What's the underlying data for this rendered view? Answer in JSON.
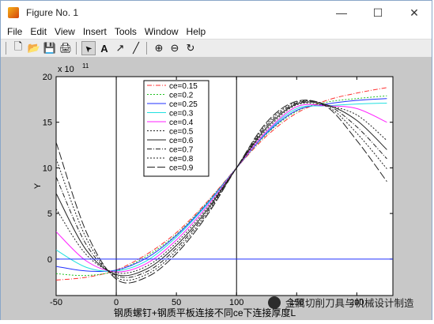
{
  "window": {
    "title": "Figure No. 1",
    "minimize": "—",
    "maximize": "☐",
    "close": "✕"
  },
  "menu": [
    "File",
    "Edit",
    "View",
    "Insert",
    "Tools",
    "Window",
    "Help"
  ],
  "toolbar": [
    {
      "name": "new-icon",
      "glyph": "🗋"
    },
    {
      "name": "open-icon",
      "glyph": "📂"
    },
    {
      "name": "save-icon",
      "glyph": "💾"
    },
    {
      "name": "print-icon",
      "glyph": "🖨"
    },
    {
      "name": "arrow-pointer-icon",
      "glyph": "➤"
    },
    {
      "name": "insert-text-icon",
      "glyph": "A"
    },
    {
      "name": "insert-arrow-icon",
      "glyph": "↗"
    },
    {
      "name": "insert-line-icon",
      "glyph": "╱"
    },
    {
      "name": "zoom-in-icon",
      "glyph": "⊕"
    },
    {
      "name": "zoom-out-icon",
      "glyph": "⊖"
    },
    {
      "name": "rotate-icon",
      "glyph": "↻"
    }
  ],
  "watermark": "金属切削刀具与机械设计制造",
  "chart_data": {
    "type": "line",
    "title": "",
    "xlabel": "钢质螺钉+钢质平板连接不同ce下连接厚度L",
    "ylabel": "Y",
    "y_exponent": "x 10",
    "y_exponent_power": "11",
    "xlim": [
      -50,
      230
    ],
    "ylim": [
      -4,
      20
    ],
    "xticks": [
      -50,
      0,
      50,
      100,
      150,
      200
    ],
    "xtick_labels": [
      "-50",
      "0",
      "50",
      "100",
      "150",
      "200"
    ],
    "yticks": [
      0,
      5,
      10,
      15,
      20
    ],
    "ytick_labels": [
      "0",
      "5",
      "10",
      "15",
      "20"
    ],
    "vlines": [
      0,
      100
    ],
    "hline": 0,
    "legend_position": "top-left",
    "series": [
      {
        "name": "ce=0.15",
        "color": "#ff3030",
        "dash": "6,2,1,2",
        "x": [
          -50,
          -25,
          0,
          25,
          50,
          75,
          100,
          125,
          150,
          175,
          200,
          225
        ],
        "y": [
          -2.3,
          -2.0,
          -1.2,
          0.5,
          2.9,
          6.2,
          10.0,
          13.5,
          16.0,
          17.4,
          18.2,
          18.8
        ]
      },
      {
        "name": "ce=0.2",
        "color": "#20c020",
        "dash": "2,2",
        "x": [
          -50,
          -25,
          0,
          25,
          50,
          75,
          100,
          125,
          150,
          175,
          200,
          225
        ],
        "y": [
          -1.6,
          -1.8,
          -1.3,
          0.3,
          2.7,
          6.1,
          10.0,
          13.7,
          16.2,
          17.2,
          17.6,
          17.9
        ]
      },
      {
        "name": "ce=0.25",
        "color": "#2030ff",
        "dash": "",
        "x": [
          -50,
          -25,
          0,
          25,
          50,
          75,
          100,
          125,
          150,
          175,
          200,
          225
        ],
        "y": [
          -0.8,
          -1.3,
          -1.2,
          0.1,
          2.6,
          6.0,
          10.0,
          13.8,
          16.3,
          17.0,
          17.4,
          17.6
        ]
      },
      {
        "name": "ce=0.3",
        "color": "#20e0e0",
        "dash": "",
        "x": [
          -50,
          -25,
          0,
          25,
          50,
          75,
          100,
          125,
          150,
          175,
          200,
          225
        ],
        "y": [
          1.0,
          -0.9,
          -1.3,
          -0.2,
          2.4,
          5.9,
          10.0,
          13.9,
          16.5,
          16.8,
          17.0,
          17.1
        ]
      },
      {
        "name": "ce=0.4",
        "color": "#ff20ff",
        "dash": "",
        "x": [
          -50,
          -25,
          0,
          25,
          50,
          75,
          100,
          125,
          150,
          175,
          200,
          225
        ],
        "y": [
          3.0,
          -0.2,
          -1.4,
          -0.5,
          2.1,
          5.7,
          10.0,
          14.0,
          16.7,
          16.8,
          16.5,
          15.0
        ]
      },
      {
        "name": "ce=0.5",
        "color": "#222222",
        "dash": "2,2",
        "x": [
          -50,
          -25,
          0,
          25,
          50,
          75,
          100,
          125,
          150,
          175,
          200,
          225
        ],
        "y": [
          5.5,
          0.5,
          -1.5,
          -0.8,
          1.8,
          5.5,
          10.0,
          14.2,
          16.9,
          16.8,
          15.8,
          13.0
        ]
      },
      {
        "name": "ce=0.6",
        "color": "#222222",
        "dash": "",
        "x": [
          -50,
          -25,
          0,
          25,
          50,
          75,
          100,
          125,
          150,
          175,
          200,
          225
        ],
        "y": [
          7.2,
          1.0,
          -1.7,
          -1.1,
          1.5,
          5.3,
          10.0,
          14.4,
          17.0,
          16.9,
          15.2,
          12.0
        ]
      },
      {
        "name": "ce=0.7",
        "color": "#222222",
        "dash": "6,2,1,2",
        "x": [
          -50,
          -25,
          0,
          25,
          50,
          75,
          100,
          125,
          150,
          175,
          200,
          225
        ],
        "y": [
          9.0,
          1.6,
          -1.8,
          -1.4,
          1.2,
          5.1,
          10.0,
          14.6,
          17.1,
          16.9,
          14.5,
          11.0
        ]
      },
      {
        "name": "ce=0.8",
        "color": "#222222",
        "dash": "2,2",
        "x": [
          -50,
          -25,
          0,
          25,
          50,
          75,
          100,
          125,
          150,
          175,
          200,
          225
        ],
        "y": [
          11.0,
          2.3,
          -2.0,
          -1.7,
          0.9,
          4.9,
          10.0,
          14.8,
          17.2,
          16.8,
          13.8,
          9.9
        ]
      },
      {
        "name": "ce=0.9",
        "color": "#222222",
        "dash": "10,3",
        "x": [
          -50,
          -25,
          0,
          25,
          50,
          75,
          100,
          125,
          150,
          175,
          200,
          225
        ],
        "y": [
          12.8,
          3.0,
          -2.2,
          -2.0,
          0.6,
          4.7,
          10.0,
          15.0,
          17.3,
          16.7,
          13.0,
          8.5
        ]
      }
    ]
  }
}
